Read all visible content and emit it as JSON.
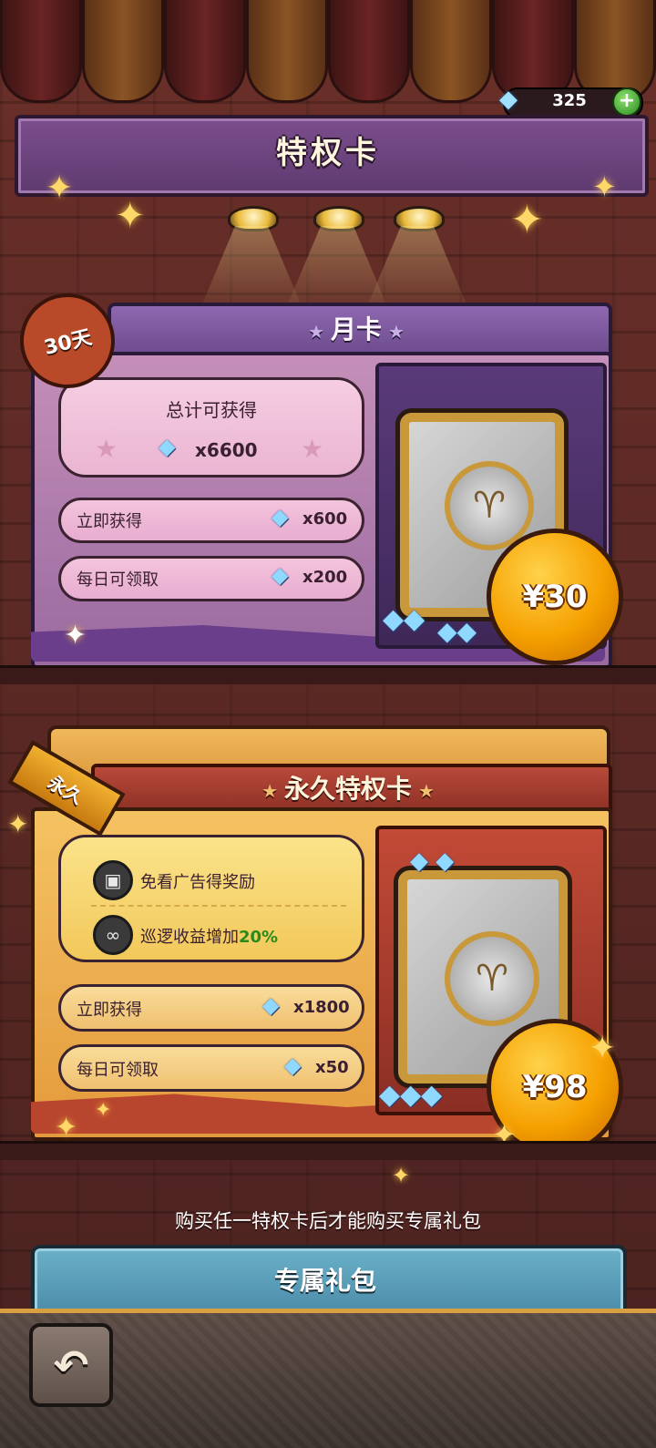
{
  "currency": {
    "icon": "diamond-icon",
    "amount": "325",
    "add_icon": "plus-icon"
  },
  "page": {
    "title": "特权卡"
  },
  "month_card": {
    "badge": "30天",
    "title": "月卡",
    "total_label": "总计可获得",
    "total_value": "x6600",
    "immediate_label": "立即获得",
    "immediate_value": "x600",
    "daily_label": "每日可领取",
    "daily_value": "x200",
    "price": "¥30"
  },
  "permanent_card": {
    "badge": "永久",
    "title": "永久特权卡",
    "perk1": "免看广告得奖励",
    "perk2_prefix": "巡逻收益增加",
    "perk2_highlight": "20%",
    "immediate_label": "立即获得",
    "immediate_value": "x1800",
    "daily_label": "每日可领取",
    "daily_value": "x50",
    "price": "¥98"
  },
  "notice": "购买任一特权卡后才能购买专属礼包",
  "exclusive_pack": {
    "label": "专属礼包"
  },
  "colors": {
    "gold": "#f5a000",
    "purple": "#8e68b0",
    "red": "#b84a3a",
    "teal": "#6ab0c8",
    "green_highlight": "#2a8a1a"
  }
}
